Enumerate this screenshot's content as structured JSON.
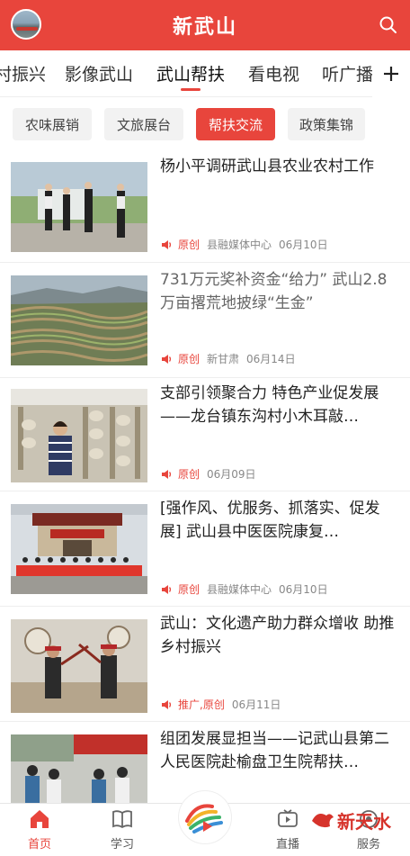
{
  "header": {
    "title": "新武山"
  },
  "channels": {
    "items": [
      {
        "label": "村振兴"
      },
      {
        "label": "影像武山"
      },
      {
        "label": "武山帮扶"
      },
      {
        "label": "看电视"
      },
      {
        "label": "听广播"
      }
    ],
    "active_index": 2
  },
  "subtabs": {
    "items": [
      {
        "label": "农味展销"
      },
      {
        "label": "文旅展台"
      },
      {
        "label": "帮扶交流"
      },
      {
        "label": "政策集锦"
      }
    ],
    "active_index": 2
  },
  "articles": [
    {
      "title": "杨小平调研武山县农业农村工作",
      "tag": "原创",
      "source": "县融媒体中心",
      "date": "06月10日"
    },
    {
      "title": "731万元奖补资金“给力” 武山2.8万亩撂荒地披绿“生金”",
      "tag": "原创",
      "source": "新甘肃",
      "date": "06月14日"
    },
    {
      "title": "支部引领聚合力 特色产业促发展——龙台镇东沟村小木耳敲…",
      "tag": "原创",
      "source": "",
      "date": "06月09日"
    },
    {
      "title": "[强作风、优服务、抓落实、促发展] 武山县中医医院康复…",
      "tag": "原创",
      "source": "县融媒体中心",
      "date": "06月10日"
    },
    {
      "title": "武山：文化遗产助力群众增收 助推乡村振兴",
      "tag": "推广,原创",
      "source": "",
      "date": "06月11日"
    },
    {
      "title": "组团发展显担当——记武山县第二人民医院赴榆盘卫生院帮扶…",
      "tag": "",
      "source": "",
      "date": ""
    }
  ],
  "bottom_nav": {
    "home": "首页",
    "study": "学习",
    "live": "直播",
    "service": "服务"
  },
  "watermark": {
    "text": "新天水"
  },
  "colors": {
    "brand": "#e8453c",
    "text": "#222222",
    "meta": "#888888"
  }
}
